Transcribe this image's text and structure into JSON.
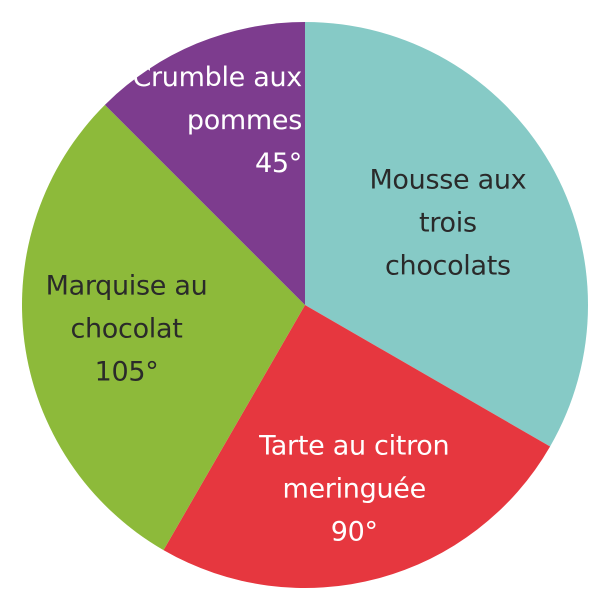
{
  "chart_data": {
    "type": "pie",
    "title": "",
    "unit": "°",
    "start_angle_deg": 0,
    "direction": "clockwise",
    "slices": [
      {
        "id": "mousse",
        "name_lines": [
          "Mousse aux",
          "trois",
          "chocolats"
        ],
        "value": 120,
        "value_label": "",
        "color": "#86cac6",
        "text_color": "#2a2a2a"
      },
      {
        "id": "tarte",
        "name_lines": [
          "Tarte au citron",
          "meringuée"
        ],
        "value": 90,
        "value_label": "90°",
        "color": "#e6373f",
        "text_color": "#ffffff"
      },
      {
        "id": "marquise",
        "name_lines": [
          "Marquise au",
          "chocolat"
        ],
        "value": 105,
        "value_label": "105°",
        "color": "#8dba3a",
        "text_color": "#2a2a2a"
      },
      {
        "id": "crumble",
        "name_lines": [
          "Crumble aux",
          "pommes"
        ],
        "value": 45,
        "value_label": "45°",
        "color": "#7d3c8e",
        "text_color": "#ffffff"
      }
    ]
  }
}
